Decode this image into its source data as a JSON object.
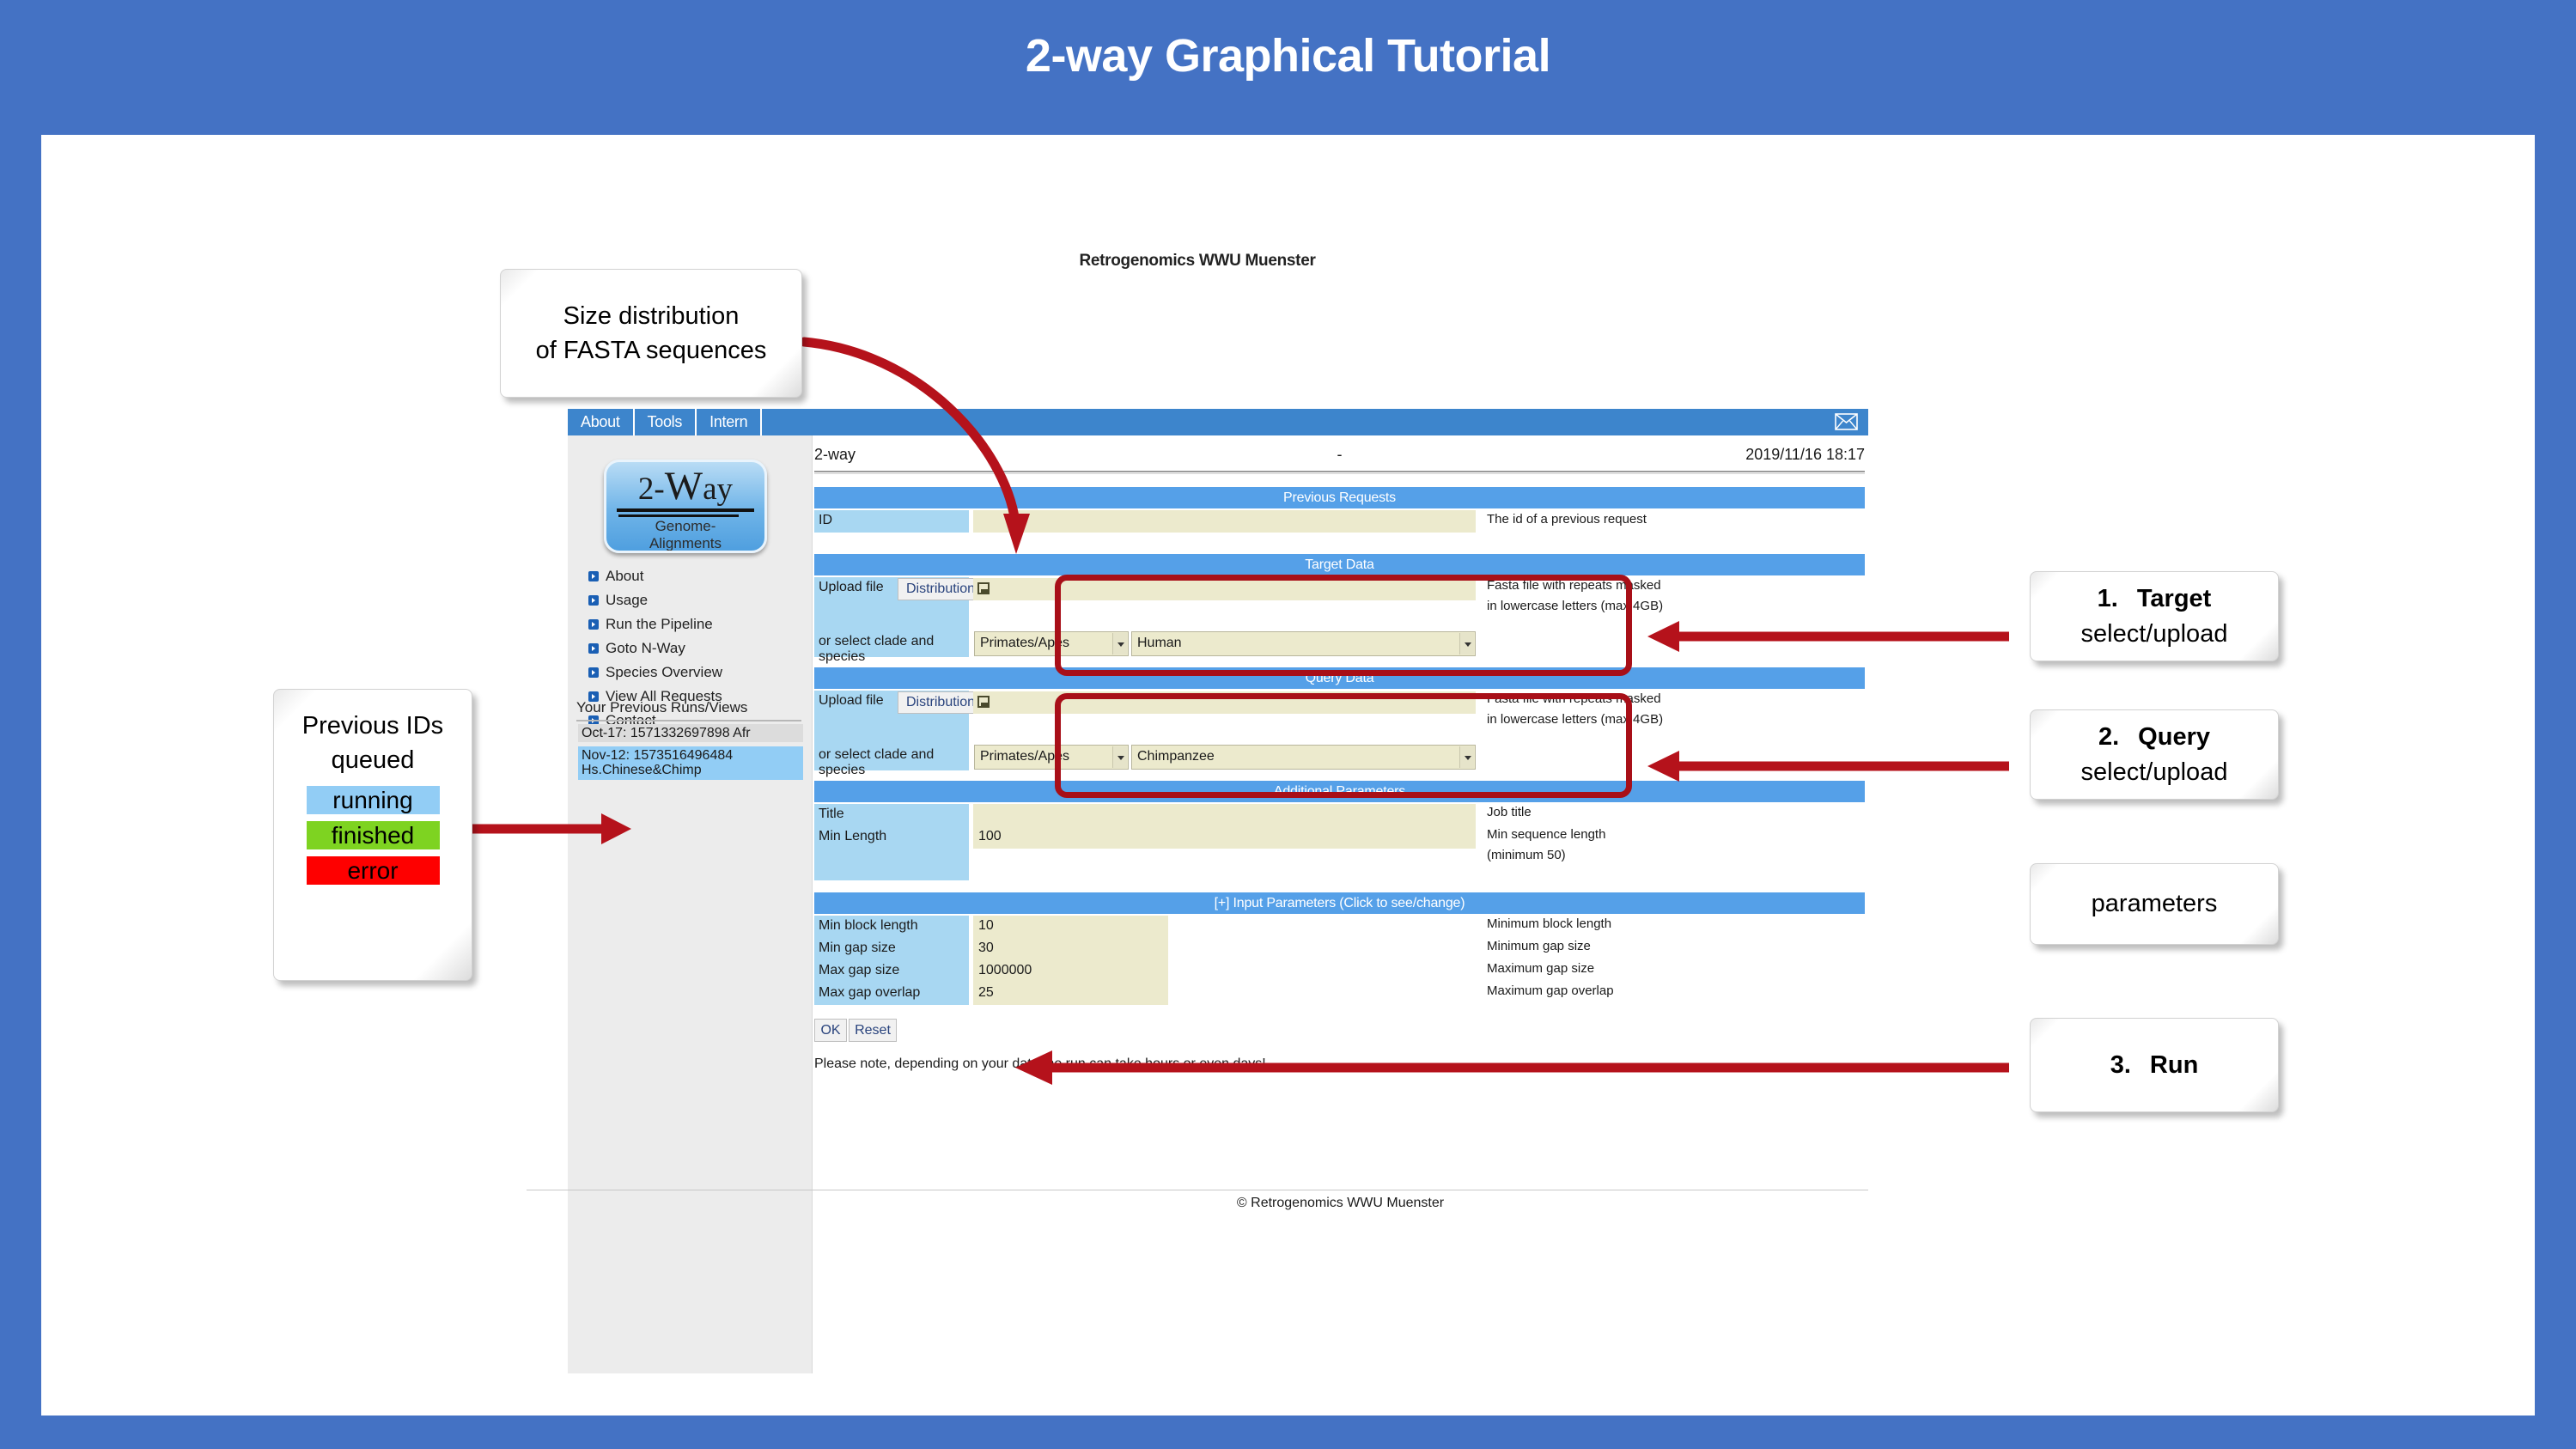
{
  "slide": {
    "title": "2-way Graphical Tutorial",
    "background_color": "#4472c4"
  },
  "callouts": {
    "size_distribution": {
      "line1": "Size distribution",
      "line2": "of FASTA sequences"
    },
    "previous_ids": {
      "line1": "Previous IDs",
      "line2": "queued",
      "statuses": [
        {
          "label": "running",
          "color": "#92cdf5"
        },
        {
          "label": "finished",
          "color": "#7ed321"
        },
        {
          "label": "error",
          "color": "#fe0000"
        }
      ]
    },
    "step1": {
      "num": "1.",
      "title": "Target",
      "subtitle": "select/upload"
    },
    "step2": {
      "num": "2.",
      "title": "Query",
      "subtitle": "select/upload"
    },
    "params": {
      "title": "parameters"
    },
    "step3": {
      "num": "3.",
      "title": "Run"
    }
  },
  "webpage": {
    "brand": "Retrogenomics WWU Muenster",
    "menu": [
      "About",
      "Tools",
      "Intern"
    ],
    "mail_icon": "envelope-icon",
    "logo": {
      "top_left": "2-",
      "top_big": "W",
      "top_right": "ay",
      "bottom_line1": "Genome-",
      "bottom_line2": "Alignments"
    },
    "nav": [
      "About",
      "Usage",
      "Run the Pipeline",
      "Goto N-Way",
      "Species Overview",
      "View All Requests",
      "Contact"
    ],
    "previous_runs": {
      "heading": "Your Previous Runs/Views",
      "items": [
        {
          "text": "Oct-17: 1571332697898 Afr",
          "state": "grey"
        },
        {
          "text": "Nov-12: 1573516496484 Hs.Chinese&Chimp",
          "state": "blue"
        }
      ]
    },
    "context": {
      "left": "2-way",
      "middle": "-",
      "right": "2019/11/16 18:17"
    },
    "sections": {
      "previous_requests": {
        "heading": "Previous Requests",
        "rows": [
          {
            "label": "ID",
            "value": "",
            "hint": "The id of a previous request"
          }
        ]
      },
      "target_data": {
        "heading": "Target Data",
        "upload_label": "Upload file",
        "distribution_button": "Distribution",
        "upload_value": "",
        "upload_hint_line1": "Fasta file with repeats masked",
        "upload_hint_line2": "in lowercase letters (max 4GB)",
        "select_label": "or select clade and species",
        "clade": "Primates/Apes",
        "species": "Human"
      },
      "query_data": {
        "heading": "Query Data",
        "upload_label": "Upload file",
        "distribution_button": "Distribution",
        "upload_value": "",
        "upload_hint_line1": "Fasta file with repeats masked",
        "upload_hint_line2": "in lowercase letters (max 4GB)",
        "select_label": "or select clade and species",
        "clade": "Primates/Apes",
        "species": "Chimpanzee"
      },
      "additional_parameters": {
        "heading": "Additional Parameters",
        "rows": [
          {
            "label": "Title",
            "value": "",
            "hint": "Job title",
            "hint2": ""
          },
          {
            "label": "Min Length",
            "value": "100",
            "hint": "Min sequence length",
            "hint2": "(minimum 50)"
          }
        ]
      },
      "input_parameters": {
        "heading": "[+] Input Parameters (Click to see/change)",
        "rows": [
          {
            "label": "Min block length",
            "value": "10",
            "hint": "Minimum block length"
          },
          {
            "label": "Min gap size",
            "value": "30",
            "hint": "Minimum gap size"
          },
          {
            "label": "Max gap size",
            "value": "1000000",
            "hint": "Maximum gap size"
          },
          {
            "label": "Max gap overlap",
            "value": "25",
            "hint": "Maximum gap overlap"
          }
        ]
      }
    },
    "buttons": {
      "ok": "OK",
      "reset": "Reset"
    },
    "note": "Please note, depending on your data the run can take hours or even days!",
    "copyright": "© Retrogenomics WWU Muenster"
  },
  "colors": {
    "slide_blue": "#4472c4",
    "section_header": "#55a0e8",
    "menu_blue": "#3d85cc",
    "label_blue": "#a8d7f2",
    "field_beige": "#eceacd",
    "highlight_red": "#a80f18"
  }
}
